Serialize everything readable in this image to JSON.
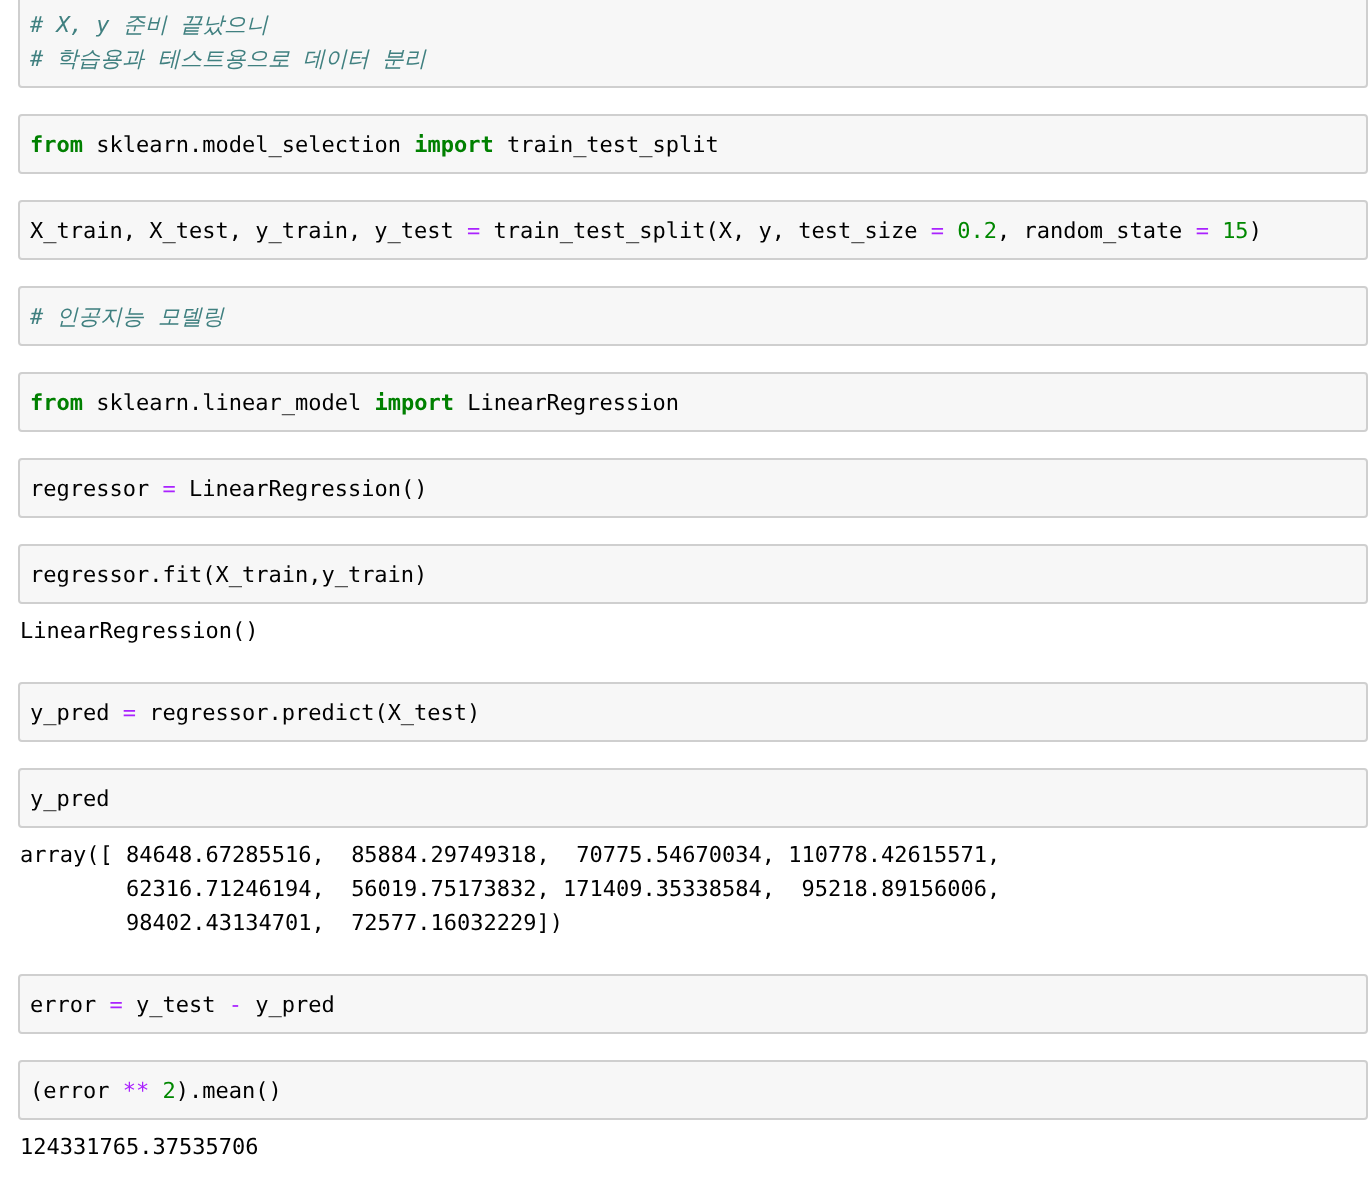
{
  "cells": [
    {
      "input": [
        [
          {
            "kind": "comment",
            "text": "# X, y 준비 끝났으니"
          }
        ],
        [
          {
            "kind": "comment",
            "text": "# 학습용과 테스트용으로 데이터 분리"
          }
        ]
      ]
    },
    {
      "input": [
        [
          {
            "kind": "keyword",
            "text": "from"
          },
          {
            "kind": "plain",
            "text": " sklearn.model_selection "
          },
          {
            "kind": "keyword",
            "text": "import"
          },
          {
            "kind": "plain",
            "text": " train_test_split"
          }
        ]
      ]
    },
    {
      "input": [
        [
          {
            "kind": "plain",
            "text": "X_train, X_test, y_train, y_test "
          },
          {
            "kind": "operator",
            "text": "="
          },
          {
            "kind": "plain",
            "text": " train_test_split(X, y, test_size "
          },
          {
            "kind": "operator",
            "text": "= "
          },
          {
            "kind": "number",
            "text": "0.2"
          },
          {
            "kind": "plain",
            "text": ", random_state "
          },
          {
            "kind": "operator",
            "text": "= "
          },
          {
            "kind": "number",
            "text": "15"
          },
          {
            "kind": "plain",
            "text": ")"
          }
        ]
      ]
    },
    {
      "input": [
        [
          {
            "kind": "comment",
            "text": "# 인공지능 모델링"
          }
        ]
      ]
    },
    {
      "input": [
        [
          {
            "kind": "keyword",
            "text": "from"
          },
          {
            "kind": "plain",
            "text": " sklearn.linear_model "
          },
          {
            "kind": "keyword",
            "text": "import"
          },
          {
            "kind": "plain",
            "text": " LinearRegression"
          }
        ]
      ]
    },
    {
      "input": [
        [
          {
            "kind": "plain",
            "text": "regressor "
          },
          {
            "kind": "operator",
            "text": "="
          },
          {
            "kind": "plain",
            "text": " LinearRegression()"
          }
        ]
      ]
    },
    {
      "input": [
        [
          {
            "kind": "plain",
            "text": "regressor.fit(X_train,y_train)"
          }
        ]
      ],
      "output": "LinearRegression()"
    },
    {
      "input": [
        [
          {
            "kind": "plain",
            "text": "y_pred "
          },
          {
            "kind": "operator",
            "text": "="
          },
          {
            "kind": "plain",
            "text": " regressor.predict(X_test)"
          }
        ]
      ]
    },
    {
      "input": [
        [
          {
            "kind": "plain",
            "text": "y_pred"
          }
        ]
      ],
      "output": "array([ 84648.67285516,  85884.29749318,  70775.54670034, 110778.42615571,\n        62316.71246194,  56019.75173832, 171409.35338584,  95218.89156006,\n        98402.43134701,  72577.16032229])"
    },
    {
      "input": [
        [
          {
            "kind": "plain",
            "text": "error "
          },
          {
            "kind": "operator",
            "text": "="
          },
          {
            "kind": "plain",
            "text": " y_test "
          },
          {
            "kind": "operator",
            "text": "-"
          },
          {
            "kind": "plain",
            "text": " y_pred"
          }
        ]
      ]
    },
    {
      "input": [
        [
          {
            "kind": "plain",
            "text": "(error "
          },
          {
            "kind": "operator",
            "text": "** "
          },
          {
            "kind": "number",
            "text": "2"
          },
          {
            "kind": "plain",
            "text": ").mean()"
          }
        ]
      ],
      "output": "124331765.37535706"
    }
  ]
}
